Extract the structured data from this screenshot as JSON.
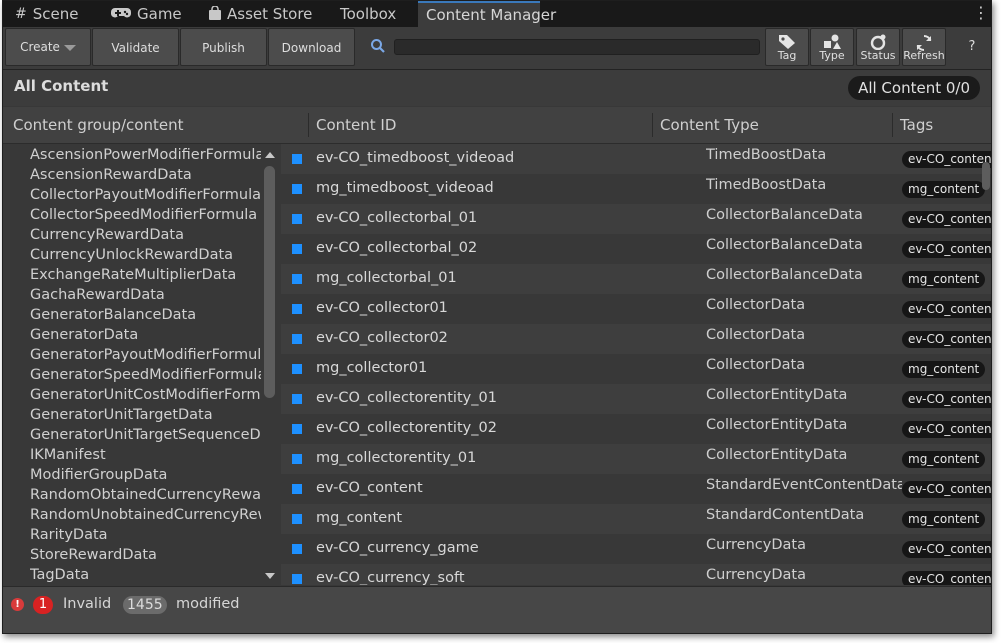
{
  "tabs": [
    {
      "label": "Scene",
      "icon": "grid-icon"
    },
    {
      "label": "Game",
      "icon": "gamepad-icon"
    },
    {
      "label": "Asset Store",
      "icon": "bag-icon"
    },
    {
      "label": "Toolbox",
      "icon": ""
    },
    {
      "label": "Content Manager",
      "icon": "",
      "active": true
    }
  ],
  "toolbar": {
    "create_label": "Create",
    "validate_label": "Validate",
    "publish_label": "Publish",
    "download_label": "Download",
    "search_value": "",
    "tag_label": "Tag",
    "type_label": "Type",
    "status_label": "Status",
    "refresh_label": "Refresh",
    "help_label": "?"
  },
  "section": {
    "title": "All Content",
    "count_label": "All Content 0/0"
  },
  "columns": {
    "group": "Content group/content",
    "id": "Content ID",
    "type": "Content Type",
    "tags": "Tags"
  },
  "groups": [
    "AscensionPowerModifierFormula",
    "AscensionRewardData",
    "CollectorPayoutModifierFormula",
    "CollectorSpeedModifierFormula",
    "CurrencyRewardData",
    "CurrencyUnlockRewardData",
    "ExchangeRateMultiplierData",
    "GachaRewardData",
    "GeneratorBalanceData",
    "GeneratorData",
    "GeneratorPayoutModifierFormula",
    "GeneratorSpeedModifierFormula",
    "GeneratorUnitCostModifierFormula",
    "GeneratorUnitTargetData",
    "GeneratorUnitTargetSequenceData",
    "IKManifest",
    "ModifierGroupData",
    "RandomObtainedCurrencyRewardData",
    "RandomUnobtainedCurrencyRewardData",
    "RarityData",
    "StoreRewardData",
    "TagData"
  ],
  "rows": [
    {
      "id": "ev-CO_timedboost_videoad",
      "type": "TimedBoostData",
      "tag": "ev-CO_content"
    },
    {
      "id": "mg_timedboost_videoad",
      "type": "TimedBoostData",
      "tag": "mg_content"
    },
    {
      "id": "ev-CO_collectorbal_01",
      "type": "CollectorBalanceData",
      "tag": "ev-CO_content"
    },
    {
      "id": "ev-CO_collectorbal_02",
      "type": "CollectorBalanceData",
      "tag": "ev-CO_content"
    },
    {
      "id": "mg_collectorbal_01",
      "type": "CollectorBalanceData",
      "tag": "mg_content"
    },
    {
      "id": "ev-CO_collector01",
      "type": "CollectorData",
      "tag": "ev-CO_content"
    },
    {
      "id": "ev-CO_collector02",
      "type": "CollectorData",
      "tag": "ev-CO_content"
    },
    {
      "id": "mg_collector01",
      "type": "CollectorData",
      "tag": "mg_content"
    },
    {
      "id": "ev-CO_collectorentity_01",
      "type": "CollectorEntityData",
      "tag": "ev-CO_content"
    },
    {
      "id": "ev-CO_collectorentity_02",
      "type": "CollectorEntityData",
      "tag": "ev-CO_content"
    },
    {
      "id": "mg_collectorentity_01",
      "type": "CollectorEntityData",
      "tag": "mg_content"
    },
    {
      "id": "ev-CO_content",
      "type": "StandardEventContentData",
      "tag": "ev-CO_content"
    },
    {
      "id": "mg_content",
      "type": "StandardContentData",
      "tag": "mg_content"
    },
    {
      "id": "ev-CO_currency_game",
      "type": "CurrencyData",
      "tag": "ev-CO_content"
    },
    {
      "id": "ev-CO_currency_soft",
      "type": "CurrencyData",
      "tag": "ev-CO_content"
    }
  ],
  "status": {
    "error_count": "1",
    "invalid_label": "Invalid",
    "modified_count": "1455",
    "modified_label": "modified"
  },
  "colors": {
    "accent": "#3a79bb",
    "content_marker": "#1e90ff",
    "error": "#d82222"
  }
}
